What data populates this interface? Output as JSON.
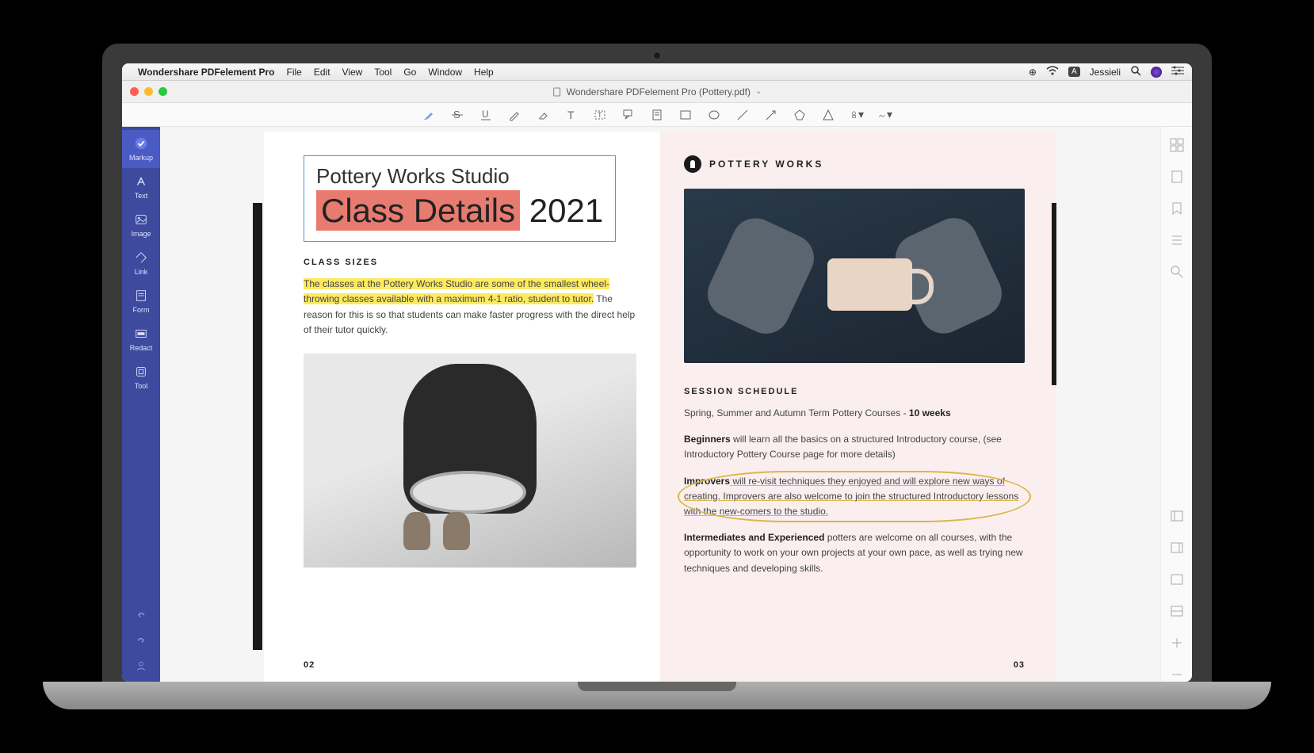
{
  "menubar": {
    "app_name": "Wondershare PDFelement Pro",
    "menus": [
      "File",
      "Edit",
      "View",
      "Tool",
      "Go",
      "Window",
      "Help"
    ],
    "user_label": "Jessieli",
    "lang_badge": "A"
  },
  "window": {
    "title": "Wondershare PDFelement Pro (Pottery.pdf)"
  },
  "sidebar_left": {
    "items": [
      {
        "key": "markup",
        "label": "Markup",
        "active": true
      },
      {
        "key": "text",
        "label": "Text"
      },
      {
        "key": "image",
        "label": "Image"
      },
      {
        "key": "link",
        "label": "Link"
      },
      {
        "key": "form",
        "label": "Form"
      },
      {
        "key": "redact",
        "label": "Redact"
      },
      {
        "key": "tool",
        "label": "Tool"
      }
    ]
  },
  "document": {
    "title_line1": "Pottery Works Studio",
    "title_highlight": "Class Details",
    "title_year": "2021",
    "class_sizes_heading": "CLASS SIZES",
    "class_sizes_hl": "The classes at the Pottery Works Studio are some of the smallest wheel-throwing classes available with a maximum 4-1 ratio, student to tutor.",
    "class_sizes_rest": " The reason for this is so that students can make faster progress with the direct help of their tutor quickly.",
    "brand_text": "POTTERY WORKS",
    "session_heading": "SESSION SCHEDULE",
    "session_line1": "Spring, Summer and Autumn Term Pottery Courses - ",
    "session_bold": "10 weeks",
    "beginners_bold": "Beginners",
    "beginners_text": " will learn all the basics on a structured Introductory course, (see Introductory Pottery Course page for more details)",
    "improvers_bold": "Improvers",
    "improvers_text_a": " will re-visit techniques they enjoyed and will explore new ",
    "improvers_text_b": "ways of creating. Improvers are also welcome to join the structured Introductory lessons with the new-comers to the studio.",
    "intermediates_bold": "Intermediates and Experienced",
    "intermediates_text": " potters are welcome on all courses, with the opportunity to work on your own projects at your own pace, as well as trying new techniques and developing skills.",
    "page_num_left": "02",
    "page_num_right": "03"
  }
}
